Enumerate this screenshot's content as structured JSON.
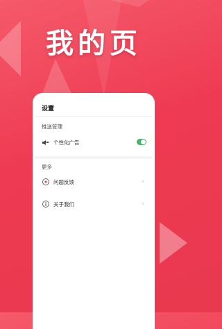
{
  "banner": {
    "title": "我的页"
  },
  "settings": {
    "header": "设置",
    "sections": [
      {
        "title": "推送管理",
        "items": [
          {
            "label": "个性化广告",
            "icon": "megaphone-icon",
            "control": "toggle",
            "on": true
          }
        ]
      },
      {
        "title": "更多",
        "items": [
          {
            "label": "问题反馈",
            "icon": "feedback-icon",
            "control": "chevron"
          },
          {
            "label": "关于我们",
            "icon": "info-icon",
            "control": "chevron"
          }
        ]
      }
    ]
  },
  "colors": {
    "accent": "#ee3a52",
    "toggle_on": "#49b36b"
  }
}
